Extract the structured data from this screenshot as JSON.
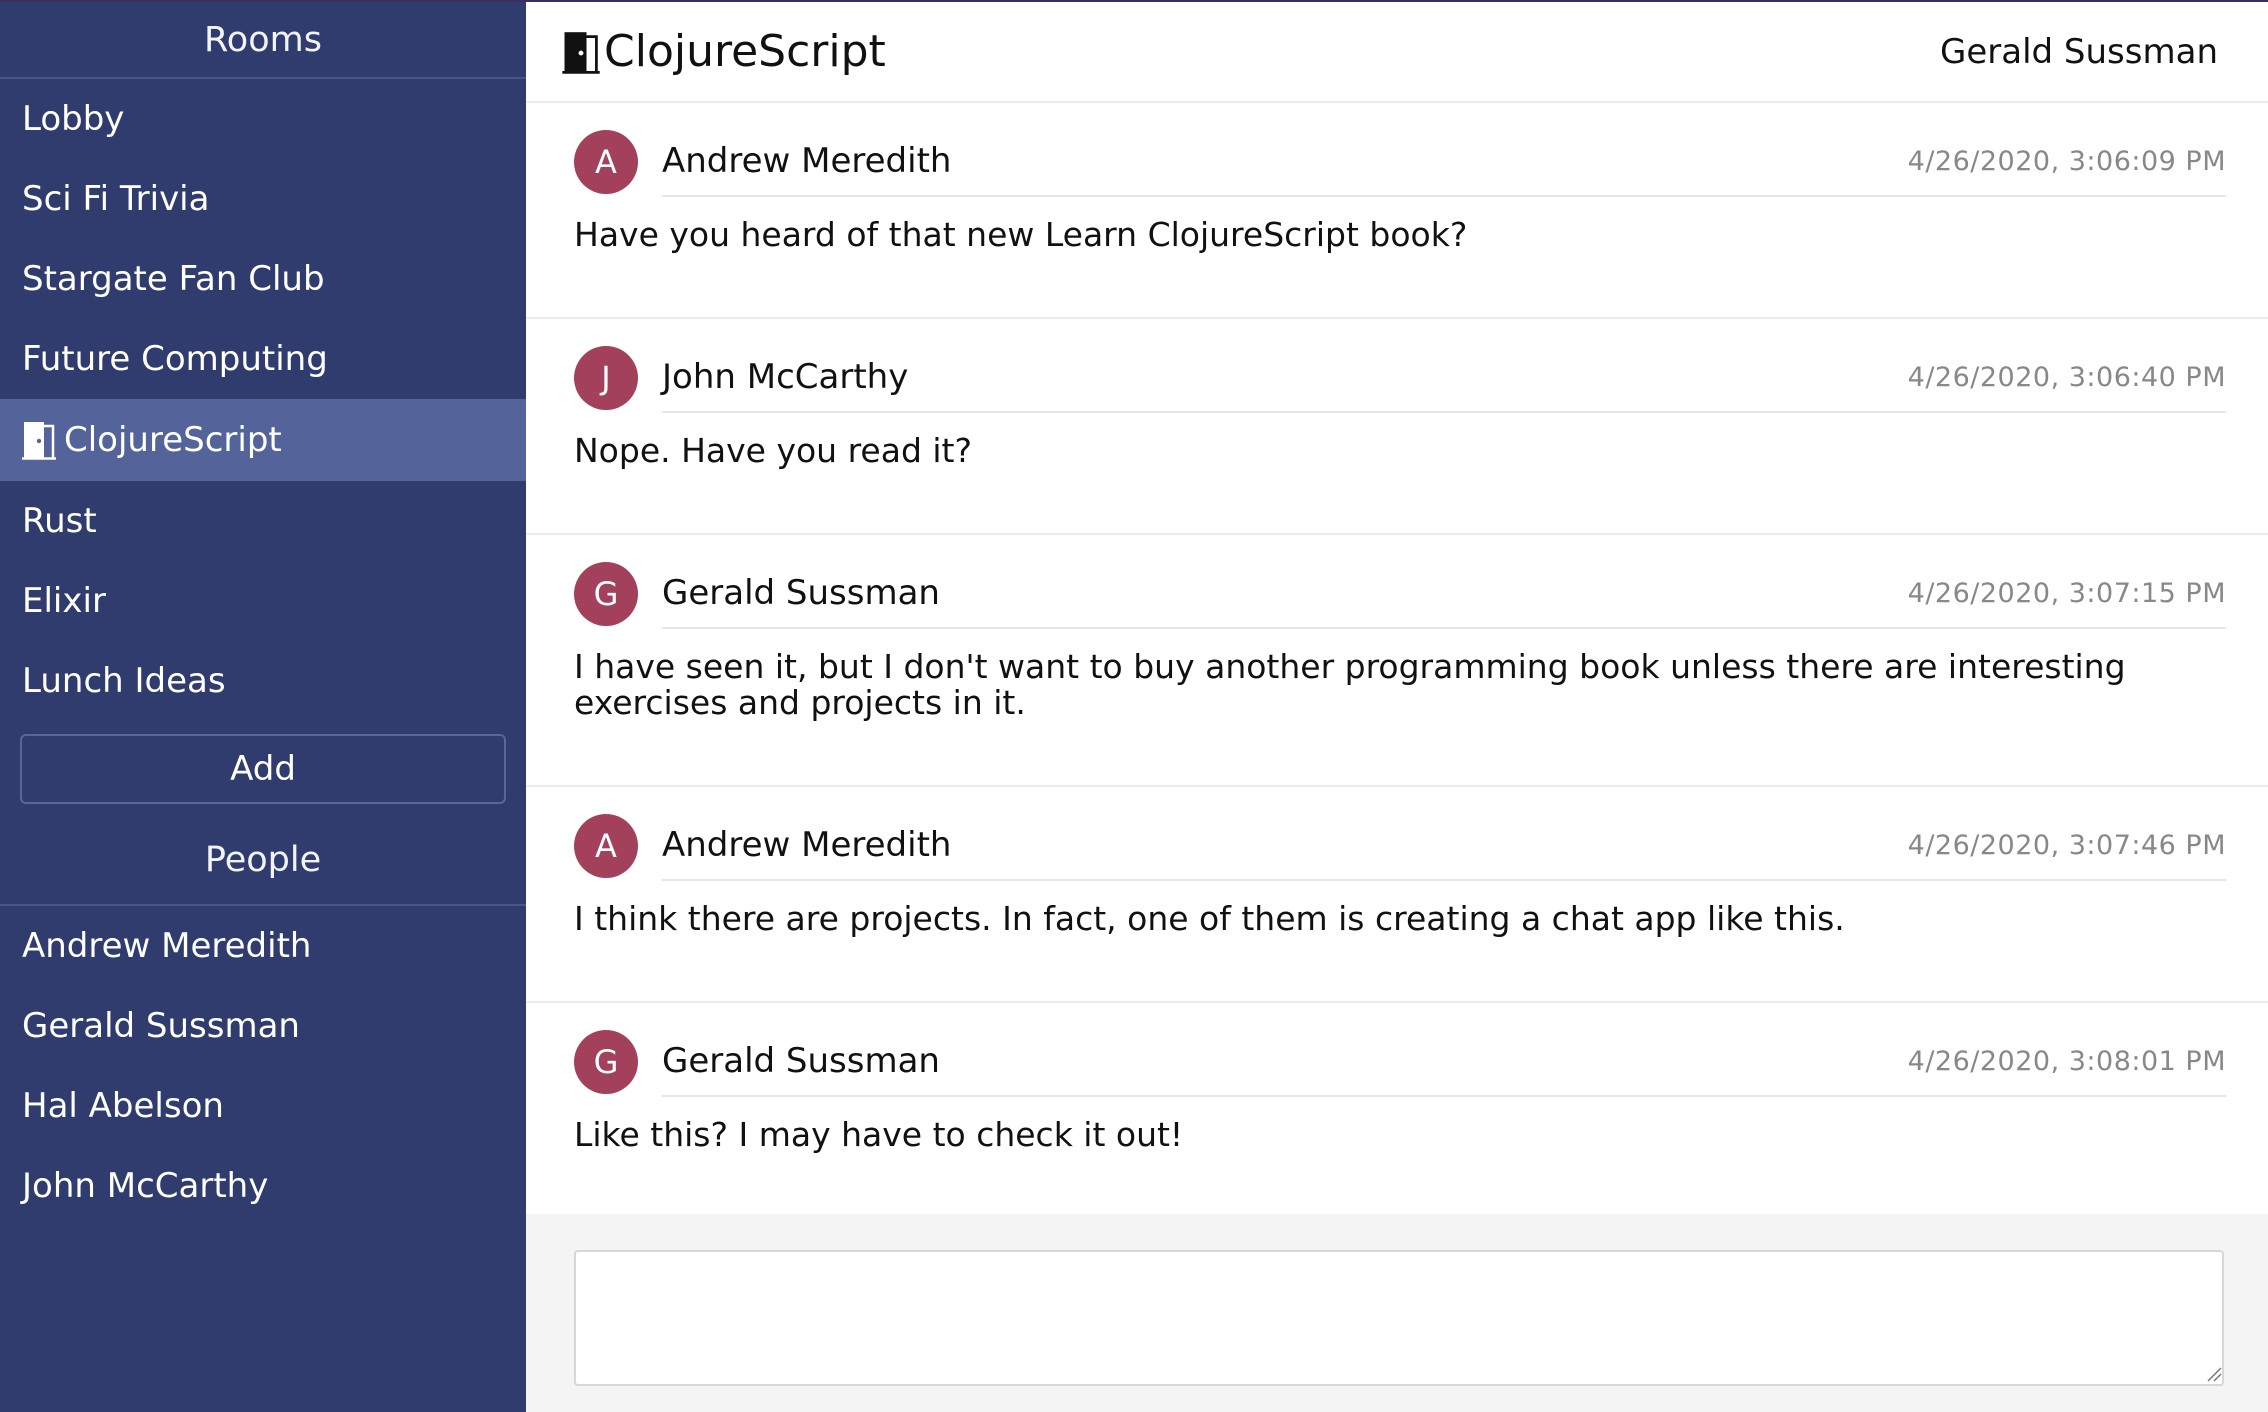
{
  "sidebar": {
    "rooms_title": "Rooms",
    "rooms": [
      {
        "label": "Lobby",
        "active": false
      },
      {
        "label": "Sci Fi Trivia",
        "active": false
      },
      {
        "label": "Stargate Fan Club",
        "active": false
      },
      {
        "label": "Future Computing",
        "active": false
      },
      {
        "label": "ClojureScript",
        "active": true,
        "icon": "door-icon"
      },
      {
        "label": "Rust",
        "active": false
      },
      {
        "label": "Elixir",
        "active": false
      },
      {
        "label": "Lunch Ideas",
        "active": false
      }
    ],
    "add_label": "Add",
    "people_title": "People",
    "people": [
      {
        "label": "Andrew Meredith"
      },
      {
        "label": "Gerald Sussman"
      },
      {
        "label": "Hal Abelson"
      },
      {
        "label": "John McCarthy"
      }
    ]
  },
  "header": {
    "room_title": "ClojureScript",
    "room_icon": "door-icon",
    "current_user": "Gerald Sussman"
  },
  "messages": [
    {
      "initial": "A",
      "author": "Andrew Meredith",
      "timestamp": "4/26/2020, 3:06:09 PM",
      "text": "Have you heard of that new Learn ClojureScript book?"
    },
    {
      "initial": "J",
      "author": "John McCarthy",
      "timestamp": "4/26/2020, 3:06:40 PM",
      "text": "Nope. Have you read it?"
    },
    {
      "initial": "G",
      "author": "Gerald Sussman",
      "timestamp": "4/26/2020, 3:07:15 PM",
      "text": "I have seen it, but I don't want to buy another programming book unless there are interesting exercises and projects in it."
    },
    {
      "initial": "A",
      "author": "Andrew Meredith",
      "timestamp": "4/26/2020, 3:07:46 PM",
      "text": "I think there are projects. In fact, one of them is creating a chat app like this."
    },
    {
      "initial": "G",
      "author": "Gerald Sussman",
      "timestamp": "4/26/2020, 3:08:01 PM",
      "text": "Like this? I may have to check it out!"
    }
  ],
  "composer": {
    "value": "",
    "placeholder": ""
  },
  "colors": {
    "sidebar_bg": "#303c6e",
    "sidebar_active": "#54639a",
    "avatar_bg": "#a3405b",
    "timestamp": "#888888"
  }
}
